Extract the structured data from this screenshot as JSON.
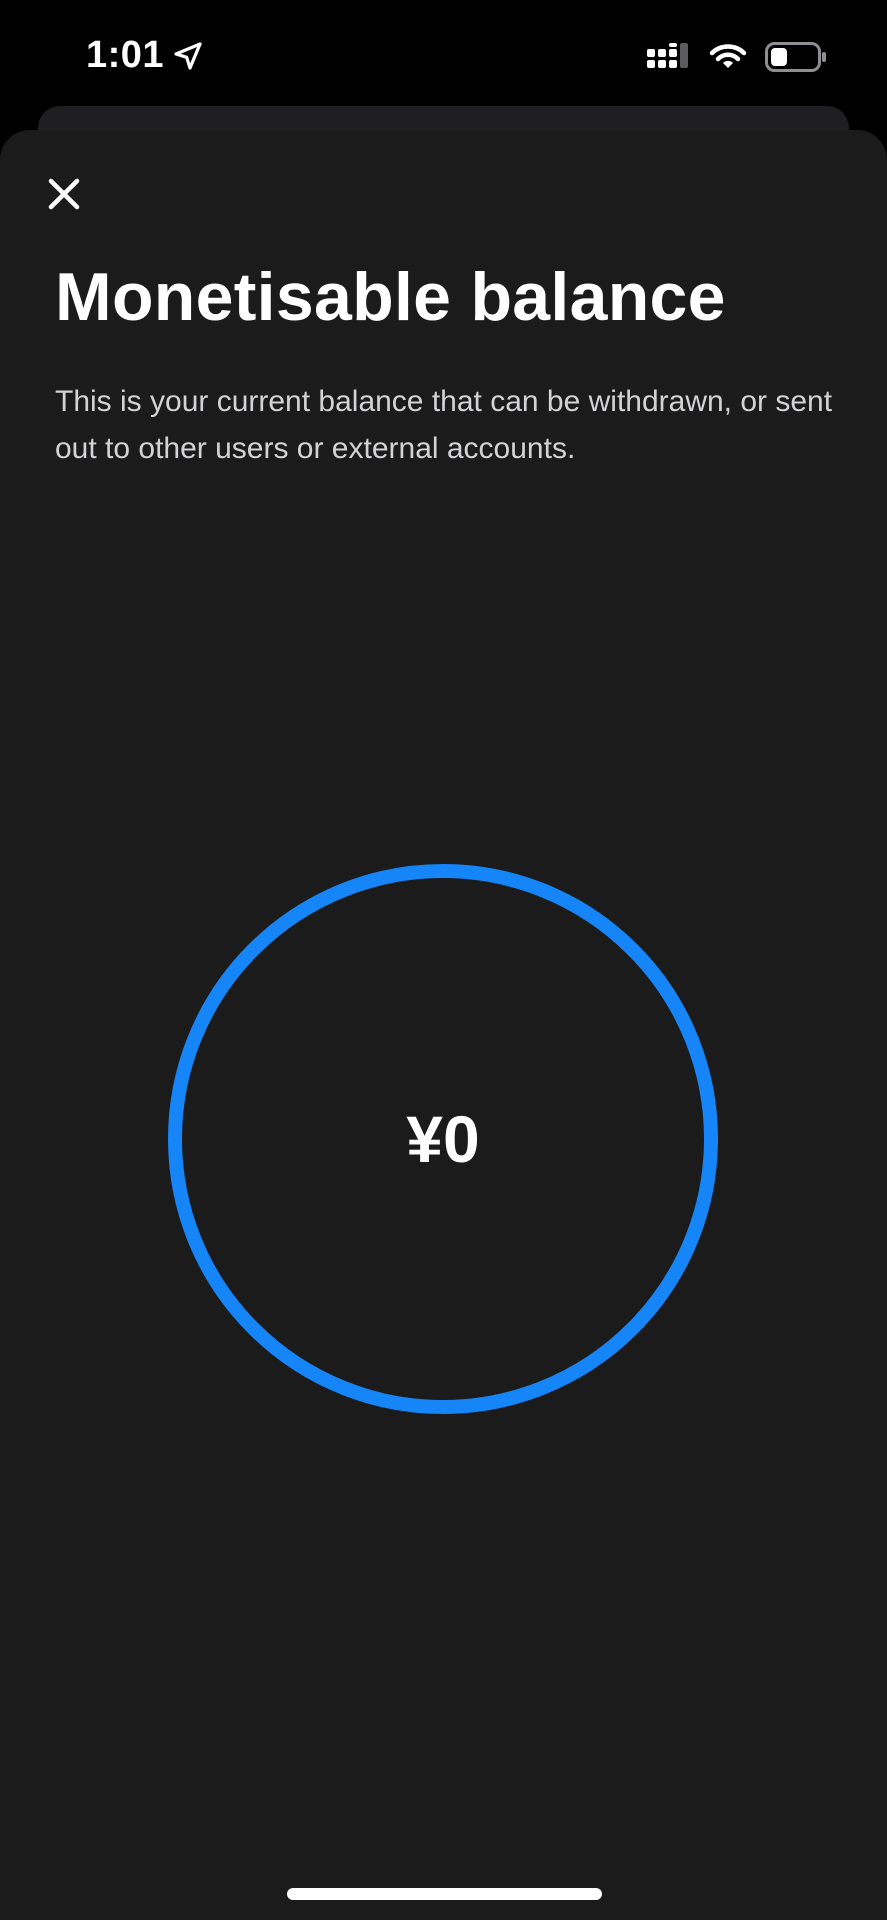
{
  "status_bar": {
    "time": "1:01",
    "icons": [
      "location-arrow-icon",
      "cellular-signal-icon",
      "wifi-icon",
      "battery-icon"
    ]
  },
  "sheet": {
    "close_icon": "close-icon",
    "title": "Monetisable balance",
    "description": "This is your current balance that can be withdrawn, or sent out to other users or external accounts.",
    "balance": "¥0"
  },
  "colors": {
    "background": "#000000",
    "sheet": "#1b1b1c",
    "ring": "#1685f8",
    "text": "#ffffff",
    "secondary_text": "#d3d3d6"
  }
}
